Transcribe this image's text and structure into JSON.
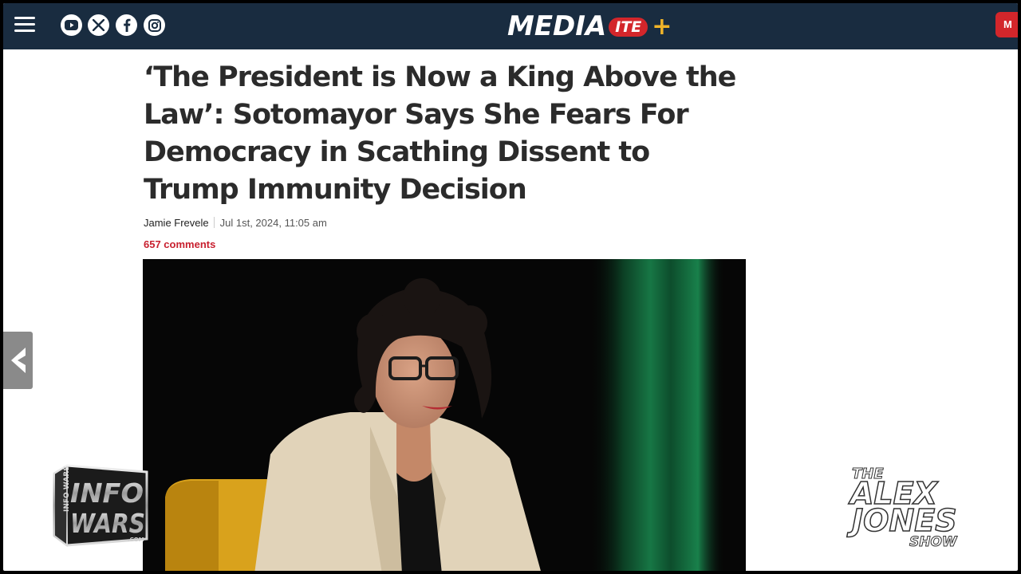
{
  "header": {
    "logo_word": "MEDIA",
    "logo_badge": "ITE",
    "logo_plus": "+",
    "signin_label": "M",
    "social_icons": [
      "youtube-icon",
      "x-icon",
      "facebook-icon",
      "instagram-icon"
    ],
    "colors": {
      "bar": "#192c40",
      "badge": "#d3262b",
      "plus": "#f0b429"
    }
  },
  "article": {
    "headline": "‘The President is Now a King Above the Law’: Sotomayor Says She Fears For Democracy in Scathing Dissent to Trump Immunity Decision",
    "author": "Jamie Frevele",
    "date": "Jul 1st, 2024, 11:05 am",
    "comments": "657 comments",
    "comments_color": "#c8202f"
  },
  "overlays": {
    "infowars_top": "INFO",
    "infowars_bottom": "WARS",
    "infowars_left": "INFO WARS",
    "infowars_com": ".COM",
    "show_the": "THE",
    "show_alex": "ALEX",
    "show_jones": "JONES",
    "show_show": "SHOW"
  }
}
